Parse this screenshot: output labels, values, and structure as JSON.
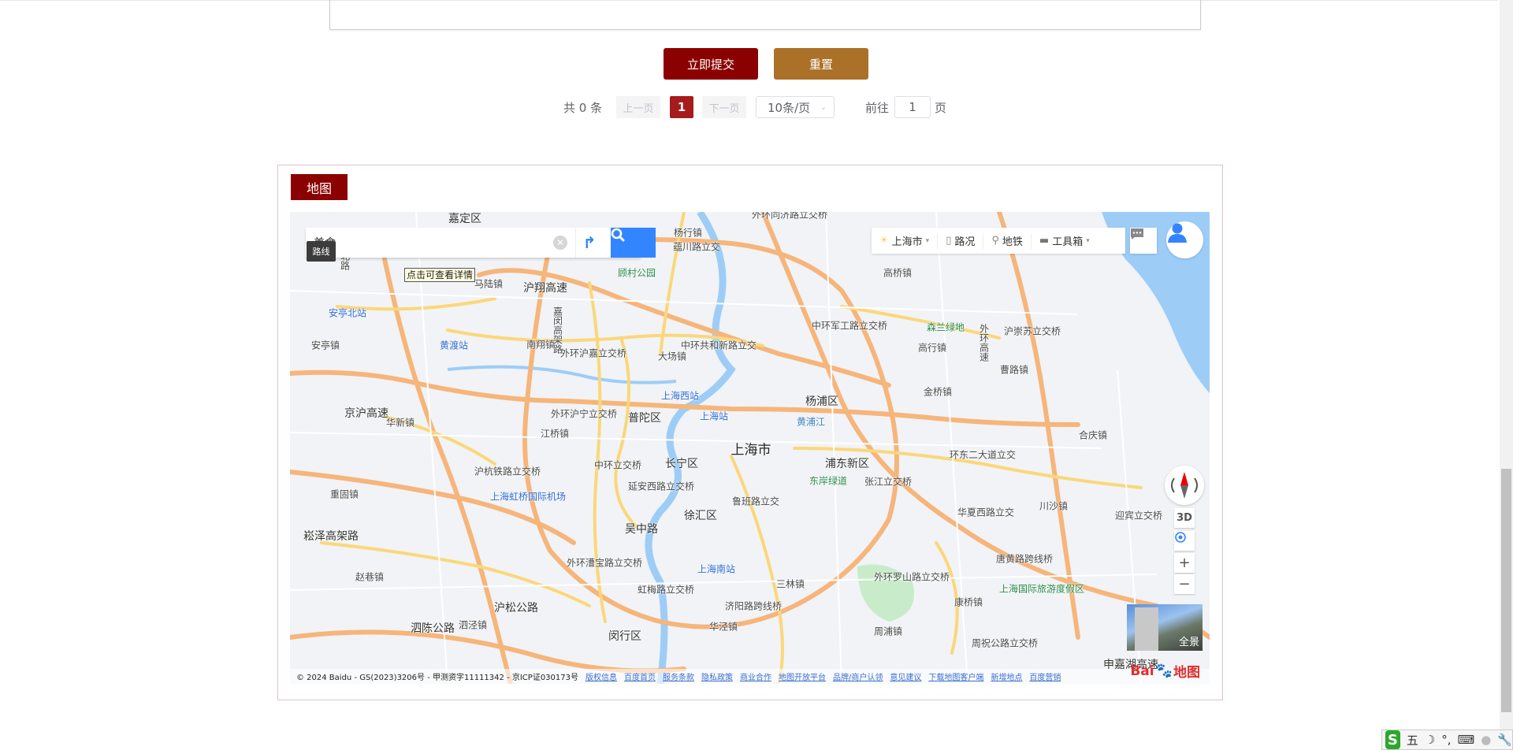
{
  "form": {
    "submit_label": "立即提交",
    "reset_label": "重置"
  },
  "pagination": {
    "total": "共 0 条",
    "prev": "上一页",
    "current": "1",
    "next": "下一页",
    "page_size": "10条/页",
    "goto_label": "前往",
    "goto_value": "1",
    "page_unit": "页"
  },
  "map_panel": {
    "title": "地图",
    "search": {
      "value": "美食",
      "route_tooltip": "路线",
      "hover_tooltip": "点击可查看详情"
    },
    "toolbar": {
      "city": "上海市",
      "traffic": "路况",
      "subway": "地铁",
      "toolbox": "工具箱"
    },
    "controls": {
      "three_d": "3D",
      "zoom_in": "+",
      "zoom_out": "−",
      "panorama": "全景"
    },
    "labels": [
      "嘉定区",
      "杨行镇",
      "蕴川路立交",
      "外环同济路立交桥",
      "顾村公园",
      "马陆镇",
      "沪翔高速",
      "安亭北站",
      "安亭镇",
      "黄渡站",
      "南翔镇",
      "外环沪嘉立交桥",
      "大场镇",
      "中环共和新路立交",
      "中环军工路立交桥",
      "高桥镇",
      "森兰绿地",
      "高行镇",
      "沪崇苏立交桥",
      "外环高速",
      "曹路镇",
      "金桥镇",
      "上海西站",
      "杨浦区",
      "外环沪宁立交桥",
      "普陀区",
      "上海站",
      "黄浦江",
      "京沪高速",
      "华新镇",
      "江桥镇",
      "上海市",
      "长宁区",
      "浦东新区",
      "中环立交桥",
      "环东二大道立交",
      "合庆镇",
      "沪杭铁路立交桥",
      "东岸绿道",
      "张江立交桥",
      "延安西路立交桥",
      "上海虹桥国际机场",
      "重固镇",
      "鲁班路立交",
      "徐汇区",
      "吴中路",
      "川沙镇",
      "华夏西路立交",
      "迎宾立交桥",
      "崧泽高架路",
      "外环漕宝路立交桥",
      "上海南站",
      "唐黄路跨线桥",
      "赵巷镇",
      "虹梅路立交桥",
      "三林镇",
      "外环罗山路立交桥",
      "上海国际旅游度假区",
      "康桥镇",
      "济阳路跨线桥",
      "泗陈公路",
      "泗泾镇",
      "沪松公路",
      "华泾镇",
      "周浦镇",
      "闵行区",
      "周祝公路立交桥",
      "申嘉湖高速",
      "嘉松北路",
      "嘉闵高架路"
    ],
    "copyright": "© 2024 Baidu - GS(2023)3206号 - 甲测资字11111342 - 京ICP证030173号",
    "footer_links": [
      "版权信息",
      "百度首页",
      "服务条款",
      "隐私政策",
      "商业合作",
      "地图开放平台",
      "品牌/商户认领",
      "意见建议",
      "下载地图客户端",
      "新增地点",
      "百度营销"
    ],
    "logo": "Baidu地图"
  },
  "ime": {
    "mode": "五",
    "punct": "°,"
  },
  "colors": {
    "primary": "#8b0000",
    "reset": "#ab7128",
    "page_active": "#a61b1b",
    "search_blue": "#3385ff"
  }
}
